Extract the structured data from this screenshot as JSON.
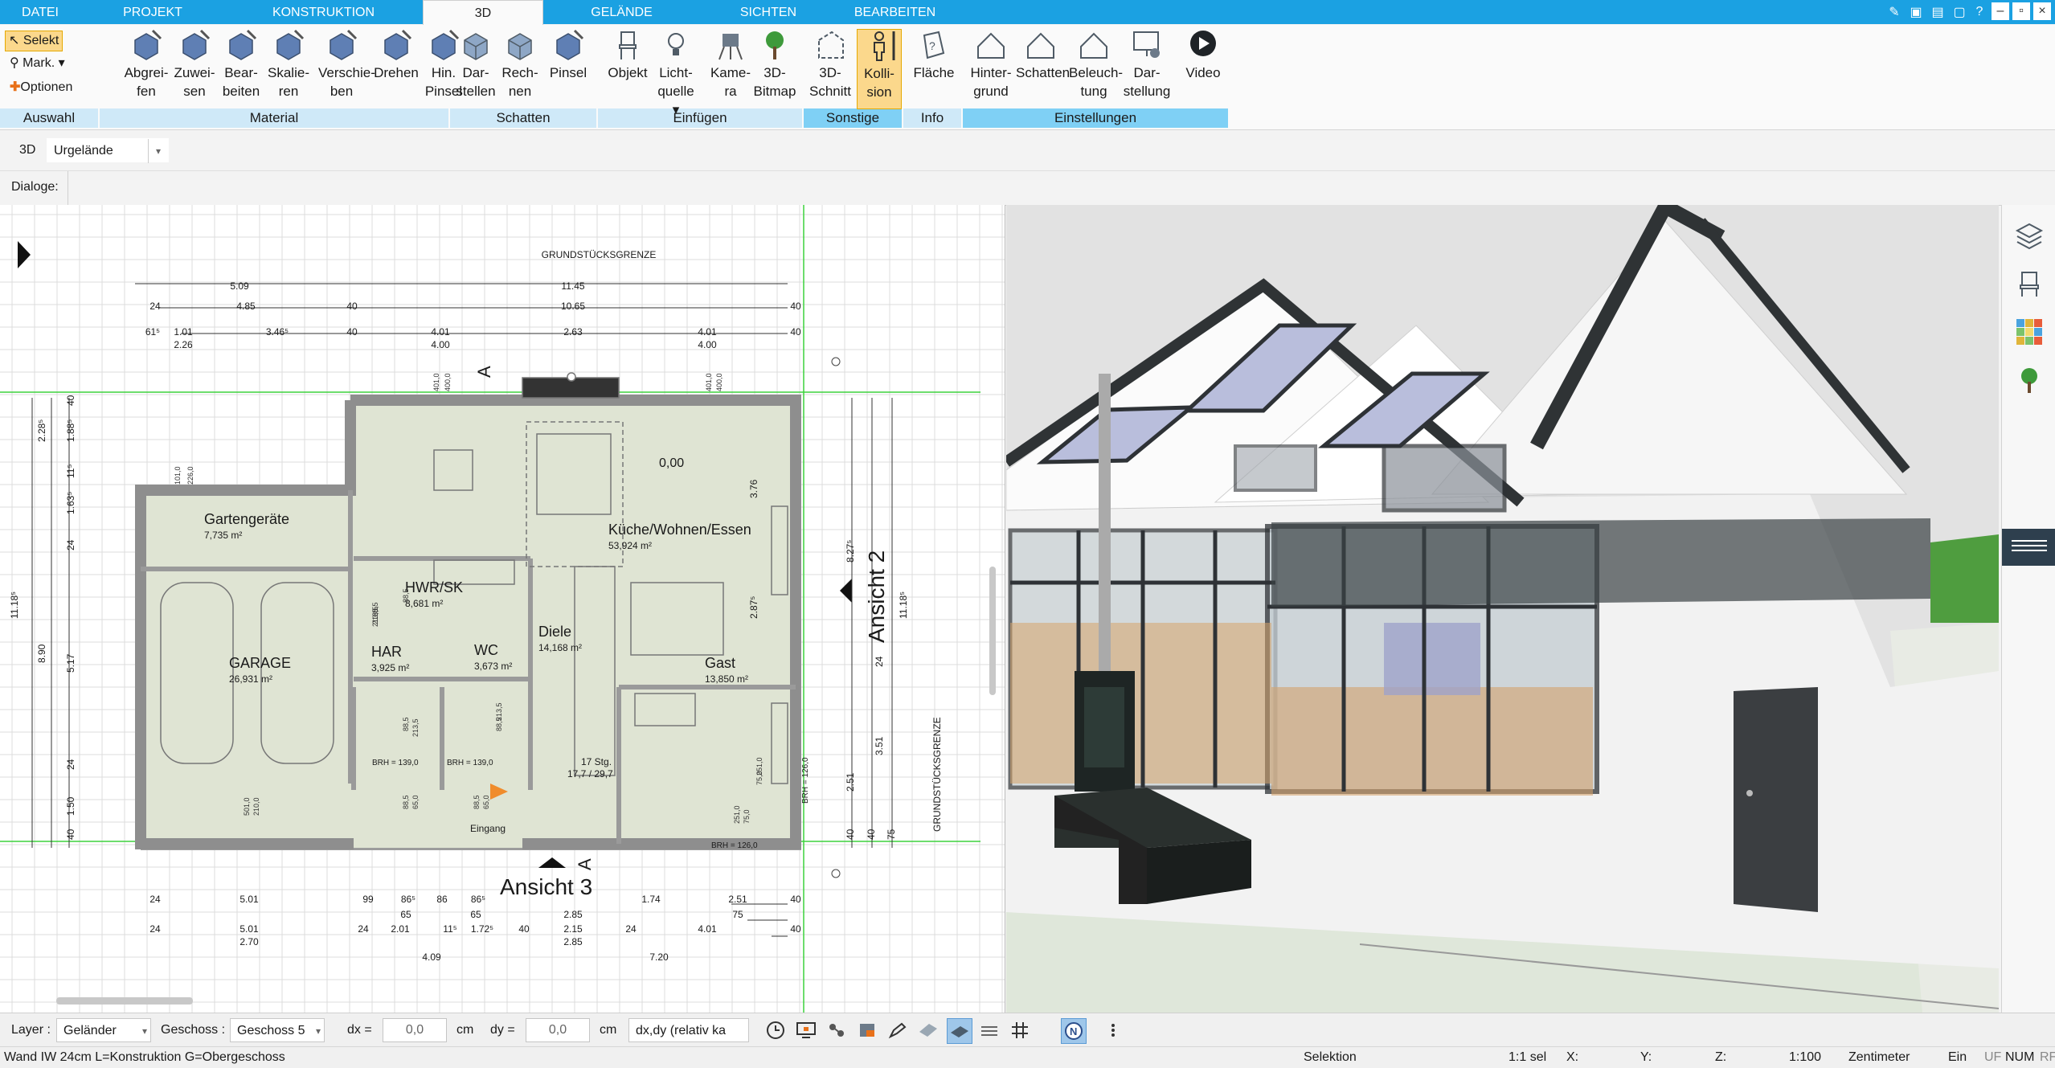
{
  "menu": {
    "tabs": [
      "DATEI",
      "PROJEKT",
      "KONSTRUKTION",
      "3D",
      "GELÄNDE",
      "SICHTEN",
      "BEARBEITEN"
    ],
    "active": "3D"
  },
  "ribbon": {
    "auswahl": {
      "selekt": "Selekt",
      "mark": "Mark.",
      "optionen": "Optionen",
      "label": "Auswahl"
    },
    "material": {
      "label": "Material",
      "buttons": [
        [
          "Abgrei-",
          "fen"
        ],
        [
          "Zuwei-",
          "sen"
        ],
        [
          "Bear-",
          "beiten"
        ],
        [
          "Skalie-",
          "ren"
        ],
        [
          "Verschie-",
          "ben"
        ],
        [
          "Drehen",
          ""
        ],
        [
          "Hin.",
          "Pinsel"
        ]
      ]
    },
    "schatten": {
      "label": "Schatten",
      "buttons": [
        [
          "Dar-",
          "stellen"
        ],
        [
          "Rech-",
          "nen"
        ],
        [
          "Pinsel",
          ""
        ]
      ]
    },
    "einfuegen": {
      "label": "Einfügen",
      "buttons": [
        [
          "Objekt",
          ""
        ],
        [
          "Licht-",
          "quelle ▾"
        ],
        [
          "Kame-",
          "ra"
        ],
        [
          "3D-",
          "Bitmap"
        ]
      ]
    },
    "sonstige": {
      "label": "Sonstige",
      "buttons": [
        [
          "3D-",
          "Schnitt"
        ],
        [
          "Kolli-",
          "sion"
        ]
      ]
    },
    "info": {
      "label": "Info",
      "buttons": [
        [
          "Fläche",
          ""
        ]
      ]
    },
    "einstellungen": {
      "label": "Einstellungen",
      "buttons": [
        [
          "Hinter-",
          "grund"
        ],
        [
          "Schatten",
          ""
        ],
        [
          "Beleuch-",
          "tung"
        ],
        [
          "Dar-",
          "stellung"
        ],
        [
          "Video",
          ""
        ]
      ]
    }
  },
  "viewbar": {
    "mode": "3D",
    "terrain": "Urgelände"
  },
  "dialoge": {
    "label": "Dialoge:"
  },
  "plan": {
    "top_label": "GRUNDSTÜCKSGRENZE",
    "right_label": "GRUNDSTÜCKSGRENZE",
    "ansicht2": "Ansicht 2",
    "ansicht3": "Ansicht 3",
    "section_marker": "A",
    "rooms": [
      {
        "name": "Gartengeräte",
        "area": "7,735 m²"
      },
      {
        "name": "Küche/Wohnen/Essen",
        "area": "53,924 m²"
      },
      {
        "name": "HWR/SK",
        "area": "8,681 m²"
      },
      {
        "name": "Diele",
        "area": "14,168 m²"
      },
      {
        "name": "HAR",
        "area": "3,925 m²"
      },
      {
        "name": "WC",
        "area": "3,673 m²"
      },
      {
        "name": "GARAGE",
        "area": "26,931 m²"
      },
      {
        "name": "Gast",
        "area": "13,850 m²"
      }
    ],
    "elevation": "0,00",
    "stairs": [
      "17 Stg.",
      "17,7 / 29,7"
    ],
    "entrance": "Eingang",
    "brh": [
      "BRH = 139,0",
      "BRH = 139,0",
      "BRH = 126,0",
      "BRH = 126,0"
    ],
    "dims_top": [
      "5.09",
      "11.45",
      "24",
      "4.85",
      "40",
      "10.65",
      "40",
      "61⁵",
      "1.01",
      "3.46⁵",
      "40",
      "4.01",
      "2.63",
      "4.01",
      "40",
      "2.26",
      "4.00",
      "4.00"
    ],
    "dims_bottom": [
      "24",
      "5.01",
      "99",
      "86⁵",
      "86",
      "86⁵",
      "1.74",
      "2.51",
      "40",
      "65",
      "65",
      "2.85",
      "75",
      "24",
      "5.01",
      "24",
      "2.01",
      "11⁵",
      "1.72⁵",
      "40",
      "2.15",
      "24",
      "4.01",
      "40",
      "2.70",
      "2.85",
      "4.09",
      "7.20"
    ],
    "dims_left": [
      "40",
      "2.28⁵",
      "1.88⁵",
      "11⁵",
      "1.63⁵",
      "24",
      "11.18⁵",
      "8.90",
      "5.17",
      "24",
      "1.50",
      "40"
    ],
    "dims_right": [
      "8.27⁵",
      "11.18⁵",
      "3.76",
      "2.87⁵",
      "24",
      "3.51",
      "2.51",
      "40",
      "40",
      "75"
    ],
    "misc": [
      "101,0",
      "226,0",
      "401,0",
      "400,0",
      "401,0",
      "400,0",
      "88,5",
      "213,5",
      "88,5",
      "213,5",
      "88,5",
      "213,5",
      "88,5",
      "213,5",
      "251,0",
      "75,0",
      "251,0",
      "75,0",
      "501,0",
      "210,0",
      "88,5",
      "65,0",
      "88,5",
      "65,0"
    ]
  },
  "bottom": {
    "layer_label": "Layer :",
    "layer_value": "Geländer",
    "geschoss_label": "Geschoss :",
    "geschoss_value": "Geschoss 5",
    "dx_label": "dx =",
    "dx_value": "0,0",
    "dy_label": "dy =",
    "dy_value": "0,0",
    "unit": "cm",
    "mode": "dx,dy (relativ ka"
  },
  "status": {
    "left": "Wand IW 24cm L=Konstruktion G=Obergeschoss",
    "selektion": "Selektion",
    "sel": "1:1 sel",
    "x": "X:",
    "y": "Y:",
    "z": "Z:",
    "scale": "1:100",
    "unit": "Zentimeter",
    "ein": "Ein",
    "uf": "UF",
    "num": "NUM",
    "rf": "RF"
  },
  "colors": {
    "accent": "#1ba1e2",
    "group_bg": "#cfe9f8",
    "selected": "#fbd88c",
    "gridline": "#d9d9d9",
    "guide_green": "#3dd23d",
    "wall": "#9a9a9a",
    "room_fill": "#dfe4d4"
  }
}
